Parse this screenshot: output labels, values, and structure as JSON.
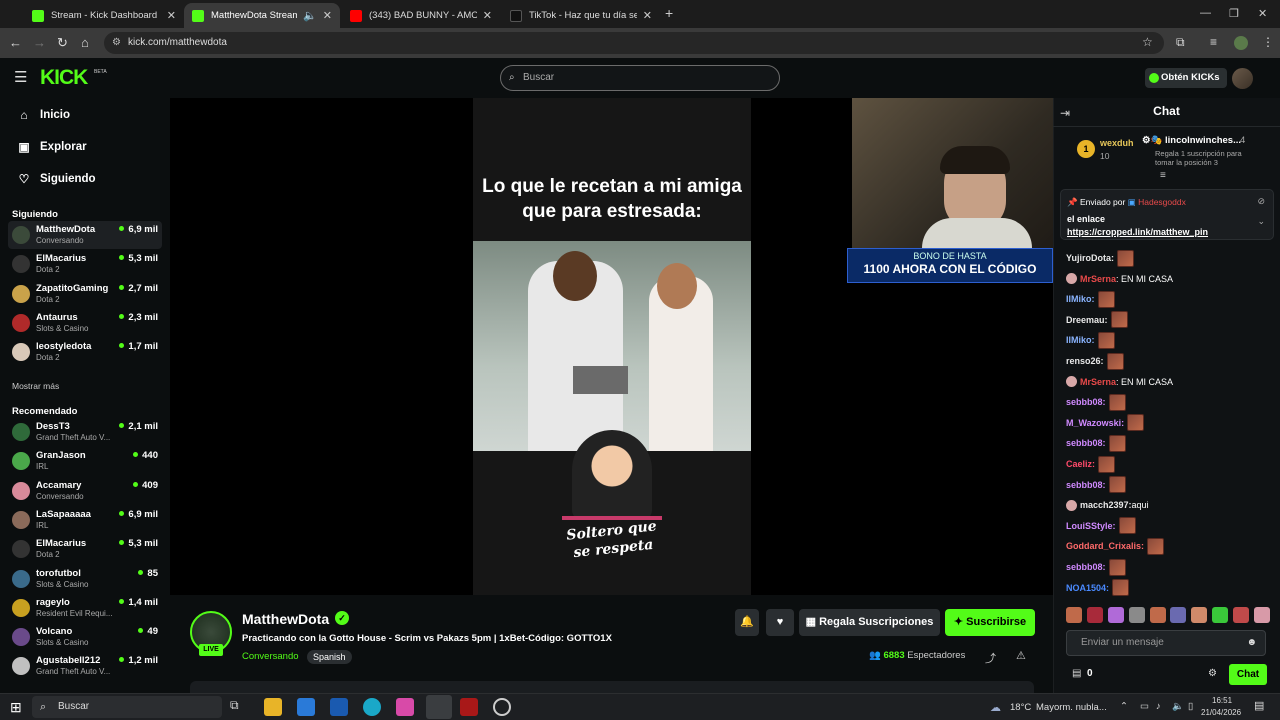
{
  "browser": {
    "tabs": [
      {
        "title": "Stream - Kick Dashboard",
        "favicon_color": "#53fc18"
      },
      {
        "title": "MatthewDota Stream - Wa",
        "favicon_color": "#53fc18"
      },
      {
        "title": "(343) BAD BUNNY - AMORFOD",
        "favicon_color": "#ff0000"
      },
      {
        "title": "TikTok - Haz que tu día sea esp",
        "favicon_color": "#111111"
      }
    ],
    "url": "kick.com/matthewdota"
  },
  "kick": {
    "logo": "KICK",
    "logo_badge": "BETA",
    "search_placeholder": "Buscar",
    "get_kicks": "Obtén KICKs"
  },
  "sidebar": {
    "nav": [
      {
        "label": "Inicio",
        "icon": "home-icon"
      },
      {
        "label": "Explorar",
        "icon": "compass-icon"
      },
      {
        "label": "Siguiendo",
        "icon": "heart-icon"
      }
    ],
    "following_title": "Siguiendo",
    "following": [
      {
        "name": "MatthewDota",
        "category": "Conversando",
        "viewers": "6,9 mil",
        "avatar_color": "#3b4a3a"
      },
      {
        "name": "ElMacarius",
        "category": "Dota 2",
        "viewers": "5,3 mil",
        "avatar_color": "#333333"
      },
      {
        "name": "ZapatitoGaming",
        "category": "Dota 2",
        "viewers": "2,7 mil",
        "avatar_color": "#c9a24a"
      },
      {
        "name": "Antaurus",
        "category": "Slots & Casino",
        "viewers": "2,3 mil",
        "avatar_color": "#b02a2a"
      },
      {
        "name": "leostyledota",
        "category": "Dota 2",
        "viewers": "1,7 mil",
        "avatar_color": "#d8c8b8"
      }
    ],
    "show_more": "Mostrar más",
    "recommended_title": "Recomendado",
    "recommended": [
      {
        "name": "DessT3",
        "category": "Grand Theft Auto V...",
        "viewers": "2,1 mil",
        "avatar_color": "#2f6a3a"
      },
      {
        "name": "GranJason",
        "category": "IRL",
        "viewers": "440",
        "avatar_color": "#4aa84a"
      },
      {
        "name": "Accamary",
        "category": "Conversando",
        "viewers": "409",
        "avatar_color": "#d88a9a"
      },
      {
        "name": "LaSapaaaaa",
        "category": "IRL",
        "viewers": "6,9 mil",
        "avatar_color": "#8a6a5a"
      },
      {
        "name": "ElMacarius",
        "category": "Dota 2",
        "viewers": "5,3 mil",
        "avatar_color": "#333333"
      },
      {
        "name": "torofutbol",
        "category": "Slots & Casino",
        "viewers": "85",
        "avatar_color": "#3a6a8a"
      },
      {
        "name": "rageylo",
        "category": "Resident Evil Requi...",
        "viewers": "1,4 mil",
        "avatar_color": "#c8a020"
      },
      {
        "name": "Volcano",
        "category": "Slots & Casino",
        "viewers": "49",
        "avatar_color": "#6a4a8a"
      },
      {
        "name": "Agustabell212",
        "category": "Grand Theft Auto V...",
        "viewers": "1,2 mil",
        "avatar_color": "#c0c0c0"
      }
    ]
  },
  "video": {
    "caption": "Lo que le recetan a mi amiga que para estresada:",
    "watermark": "Soltero que se respeta"
  },
  "webcam": {
    "promo_line1": "BONO DE HASTA",
    "promo_line2": "1100 AHORA CON EL CÓDIGO"
  },
  "stream": {
    "name": "MatthewDota",
    "title": "Practicando con la Gotto House - Scrim vs Pakazs 5pm | 1xBet-Código: GOTTO1X",
    "category": "Conversando",
    "language": "Spanish",
    "live_badge": "LIVE",
    "gift_subs": "Regala Suscripciones",
    "subscribe": "Suscribirse",
    "viewers_count": "6883",
    "viewers_label": "Espectadores"
  },
  "chat": {
    "title": "Chat",
    "top_rank": "1",
    "top_user": "wexduh",
    "top_count": "10",
    "gifter": "lincolnwinches...",
    "gifter_count": "4",
    "gifter_note": "Regala 1 suscripción para tomar la posición 3",
    "pinned_by": "Enviado por",
    "pinned_user": "Hadesgoddx",
    "pinned_text": "el enlace",
    "pinned_link": "https://cropped.link/matthew_pin",
    "messages": [
      {
        "user": "YujiroDota:",
        "color": "#e8e8e8",
        "text": "",
        "emote": true
      },
      {
        "user": "MrSerna",
        "color": "#e84a4a",
        "text": ": EN MI CASA",
        "emote": false
      },
      {
        "user": "IlMiko:",
        "color": "#8ab4ff",
        "text": "",
        "emote": true
      },
      {
        "user": "Dreemau:",
        "color": "#e8e8e8",
        "text": "",
        "emote": true
      },
      {
        "user": "IlMiko:",
        "color": "#8ab4ff",
        "text": "",
        "emote": true
      },
      {
        "user": "renso26:",
        "color": "#e8e8e8",
        "text": "",
        "emote": true
      },
      {
        "user": "MrSerna",
        "color": "#e84a4a",
        "text": ": EN MI CASA",
        "emote": false
      },
      {
        "user": "sebbb08:",
        "color": "#d08aff",
        "text": "",
        "emote": true
      },
      {
        "user": "M_Wazowski:",
        "color": "#d08aff",
        "text": "",
        "emote": true
      },
      {
        "user": "sebbb08:",
        "color": "#d08aff",
        "text": "",
        "emote": true
      },
      {
        "user": "Caeliz:",
        "color": "#ff4a6a",
        "text": "",
        "emote": true
      },
      {
        "user": "sebbb08:",
        "color": "#d08aff",
        "text": "",
        "emote": true
      },
      {
        "user": "macch2397:",
        "color": "#e8e8e8",
        "text": " aqui",
        "emote": false
      },
      {
        "user": "LouiSStyle:",
        "color": "#d08aff",
        "text": "",
        "emote": true
      },
      {
        "user": "Goddard_Crixalis:",
        "color": "#ff6a6a",
        "text": "",
        "emote": true
      },
      {
        "user": "sebbb08:",
        "color": "#d08aff",
        "text": "",
        "emote": true
      },
      {
        "user": "NOA1504:",
        "color": "#4a8aff",
        "text": "",
        "emote": true
      }
    ],
    "input_placeholder": "Enviar un mensaje",
    "kicks_balance": "0",
    "send_button": "Chat"
  },
  "taskbar": {
    "search": "Buscar",
    "weather": "18°C",
    "weather_text": "Mayorm. nubla...",
    "time": "16:51",
    "date": "21/04/2026"
  }
}
